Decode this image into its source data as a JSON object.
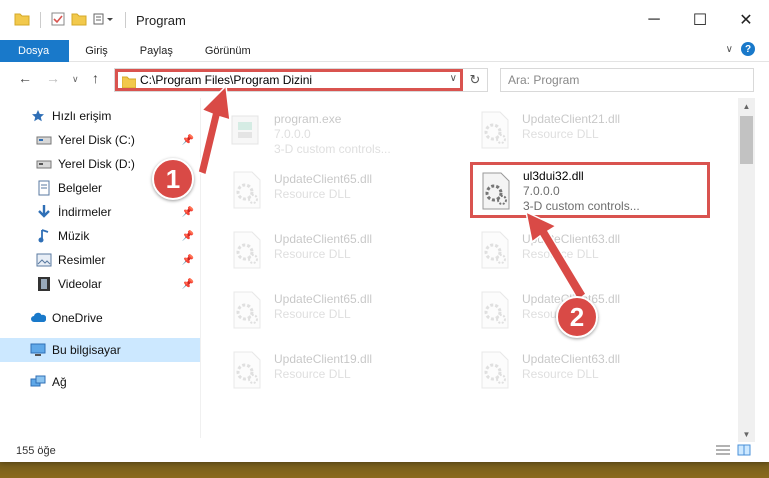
{
  "window": {
    "title": "Program",
    "controls": {
      "minimize": "─",
      "maximize": "☐",
      "close": "✕"
    }
  },
  "ribbon": {
    "tabs": [
      "Dosya",
      "Giriş",
      "Paylaş",
      "Görünüm"
    ],
    "help": "?"
  },
  "address": {
    "path": "C:\\Program Files\\Program Dizini",
    "search_placeholder": "Ara: Program"
  },
  "sidebar": {
    "items": [
      {
        "label": "Hızlı erişim",
        "icon": "star-icon"
      },
      {
        "label": "Yerel Disk (C:)",
        "icon": "drive-icon"
      },
      {
        "label": "Yerel Disk (D:)",
        "icon": "drive-icon"
      },
      {
        "label": "Belgeler",
        "icon": "documents-icon"
      },
      {
        "label": "İndirmeler",
        "icon": "download-icon"
      },
      {
        "label": "Müzik",
        "icon": "music-icon"
      },
      {
        "label": "Resimler",
        "icon": "pictures-icon"
      },
      {
        "label": "Videolar",
        "icon": "video-icon"
      },
      {
        "label": "OneDrive",
        "icon": "cloud-icon"
      },
      {
        "label": "Bu bilgisayar",
        "icon": "computer-icon"
      },
      {
        "label": "Ağ",
        "icon": "network-icon"
      }
    ]
  },
  "files": [
    {
      "name": "program.exe",
      "line2": "7.0.0.0",
      "line3": "3-D custom controls...",
      "icon": "exe-icon",
      "faded": true
    },
    {
      "name": "UpdateClient21.dll",
      "line2": "Resource DLL",
      "line3": "",
      "icon": "dll-icon",
      "faded": true
    },
    {
      "name": "UpdateClient65.dll",
      "line2": "Resource DLL",
      "line3": "",
      "icon": "dll-icon",
      "faded": true
    },
    {
      "name": "ul3dui32.dll",
      "line2": "7.0.0.0",
      "line3": "3-D custom controls...",
      "icon": "dll-icon",
      "faded": false,
      "highlight": true
    },
    {
      "name": "UpdateClient65.dll",
      "line2": "Resource DLL",
      "line3": "",
      "icon": "dll-icon",
      "faded": true
    },
    {
      "name": "UpdateClient63.dll",
      "line2": "Resource DLL",
      "line3": "",
      "icon": "dll-icon",
      "faded": true
    },
    {
      "name": "UpdateClient65.dll",
      "line2": "Resource DLL",
      "line3": "",
      "icon": "dll-icon",
      "faded": true
    },
    {
      "name": "UpdateClient65.dll",
      "line2": "Resource DLL",
      "line3": "",
      "icon": "dll-icon",
      "faded": true
    },
    {
      "name": "UpdateClient19.dll",
      "line2": "Resource DLL",
      "line3": "",
      "icon": "dll-icon",
      "faded": true
    },
    {
      "name": "UpdateClient63.dll",
      "line2": "Resource DLL",
      "line3": "",
      "icon": "dll-icon",
      "faded": true
    }
  ],
  "status": {
    "count": "155 öğe"
  },
  "markers": [
    "1",
    "2"
  ],
  "colors": {
    "accent": "#1979ca",
    "highlight": "#d9534f",
    "selected": "#cce8ff"
  }
}
